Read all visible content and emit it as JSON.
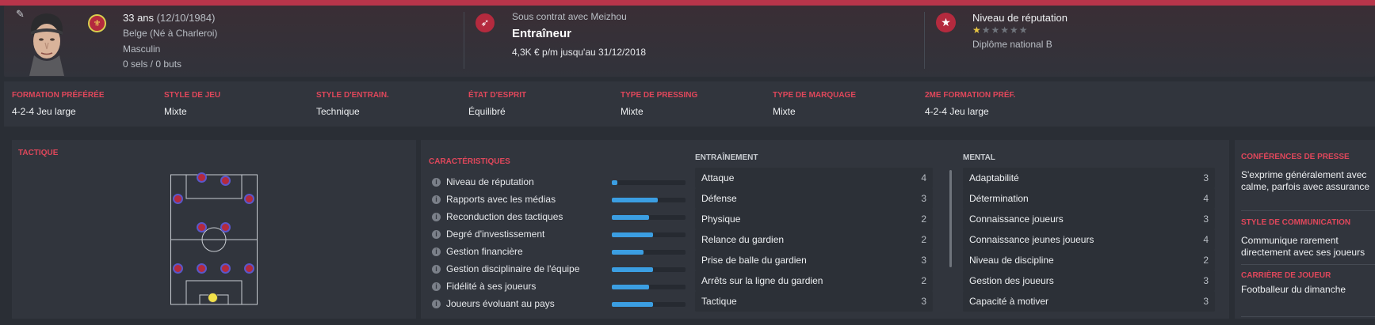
{
  "header": {
    "age": "33 ans",
    "birthdate": "(12/10/1984)",
    "nationality": "Belge (Né à Charleroi)",
    "gender": "Masculin",
    "caps": "0 sels / 0 buts",
    "contract": "Sous contrat avec Meizhou",
    "role": "Entraîneur",
    "salary": "4,3K € p/m jusqu'au 31/12/2018",
    "reputation_title": "Niveau de réputation",
    "reputation_stars": 0.5,
    "diploma": "Diplôme national B"
  },
  "attributes": [
    {
      "label": "FORMATION PRÉFÉRÉE",
      "value": "4-2-4 Jeu large"
    },
    {
      "label": "STYLE DE JEU",
      "value": "Mixte"
    },
    {
      "label": "STYLE D'ENTRAIN.",
      "value": "Technique"
    },
    {
      "label": "ÉTAT D'ESPRIT",
      "value": "Équilibré"
    },
    {
      "label": "TYPE DE PRESSING",
      "value": "Mixte"
    },
    {
      "label": "TYPE DE MARQUAGE",
      "value": "Mixte"
    },
    {
      "label": "2ME FORMATION PRÉF.",
      "value": "4-2-4 Jeu large"
    }
  ],
  "tactics": {
    "title": "TACTIQUE"
  },
  "characteristics": {
    "title": "CARACTÉRISTIQUES",
    "items": [
      {
        "name": "Niveau de réputation",
        "level": 0.08
      },
      {
        "name": "Rapports avec les médias",
        "level": 0.62
      },
      {
        "name": "Reconduction des tactiques",
        "level": 0.5
      },
      {
        "name": "Degré d'investissement",
        "level": 0.56
      },
      {
        "name": "Gestion financière",
        "level": 0.43
      },
      {
        "name": "Gestion disciplinaire de l'équipe",
        "level": 0.56
      },
      {
        "name": "Fidélité à ses joueurs",
        "level": 0.5
      },
      {
        "name": "Joueurs évoluant au pays",
        "level": 0.56
      }
    ]
  },
  "training": {
    "title": "ENTRAÎNEMENT",
    "items": [
      {
        "name": "Attaque",
        "value": "4"
      },
      {
        "name": "Défense",
        "value": "3"
      },
      {
        "name": "Physique",
        "value": "2"
      },
      {
        "name": "Relance du gardien",
        "value": "2"
      },
      {
        "name": "Prise de balle du gardien",
        "value": "3"
      },
      {
        "name": "Arrêts sur la ligne du gardien",
        "value": "2"
      },
      {
        "name": "Tactique",
        "value": "3"
      }
    ]
  },
  "mental": {
    "title": "MENTAL",
    "items": [
      {
        "name": "Adaptabilité",
        "value": "3"
      },
      {
        "name": "Détermination",
        "value": "4"
      },
      {
        "name": "Connaissance joueurs",
        "value": "3"
      },
      {
        "name": "Connaissance jeunes joueurs",
        "value": "4"
      },
      {
        "name": "Niveau de discipline",
        "value": "2"
      },
      {
        "name": "Gestion des joueurs",
        "value": "3"
      },
      {
        "name": "Capacité à motiver",
        "value": "3"
      }
    ]
  },
  "right_panel": {
    "press_title": "CONFÉRENCES DE PRESSE",
    "press_text": "S'exprime généralement avec calme, parfois avec assurance",
    "comm_title": "STYLE DE COMMUNICATION",
    "comm_text": "Communique rarement directement avec ses joueurs",
    "career_title": "CARRIÈRE DE JOUEUR",
    "career_text": "Footballeur du dimanche"
  },
  "colors": {
    "accent": "#e0475b",
    "bar": "#3b9ee2",
    "player": "#b42a3e",
    "keeper": "#f2e14a"
  }
}
